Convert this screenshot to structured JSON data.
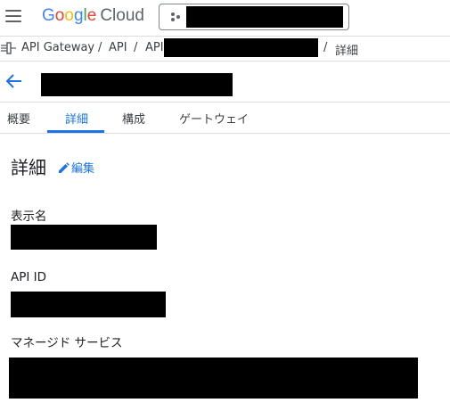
{
  "topbar": {
    "logo": {
      "g1": "G",
      "g2": "o",
      "g3": "o",
      "g4": "g",
      "g5": "l",
      "g6": "e",
      "product": "Cloud"
    },
    "menu_icon": "hamburger-icon"
  },
  "breadcrumb": {
    "items": [
      "API Gateway",
      "API",
      "API",
      "詳細"
    ],
    "separator": "/"
  },
  "tabs": [
    {
      "label": "概要",
      "active": false
    },
    {
      "label": "詳細",
      "active": true
    },
    {
      "label": "構成",
      "active": false
    },
    {
      "label": "ゲートウェイ",
      "active": false
    }
  ],
  "details": {
    "title": "詳細",
    "edit_label": "編集",
    "fields": {
      "display_name_label": "表示名",
      "api_id_label": "API ID",
      "managed_service_label": "マネージド サービス"
    }
  },
  "colors": {
    "accent": "#1a73e8",
    "divider": "#dadce0",
    "text": "#202124"
  }
}
